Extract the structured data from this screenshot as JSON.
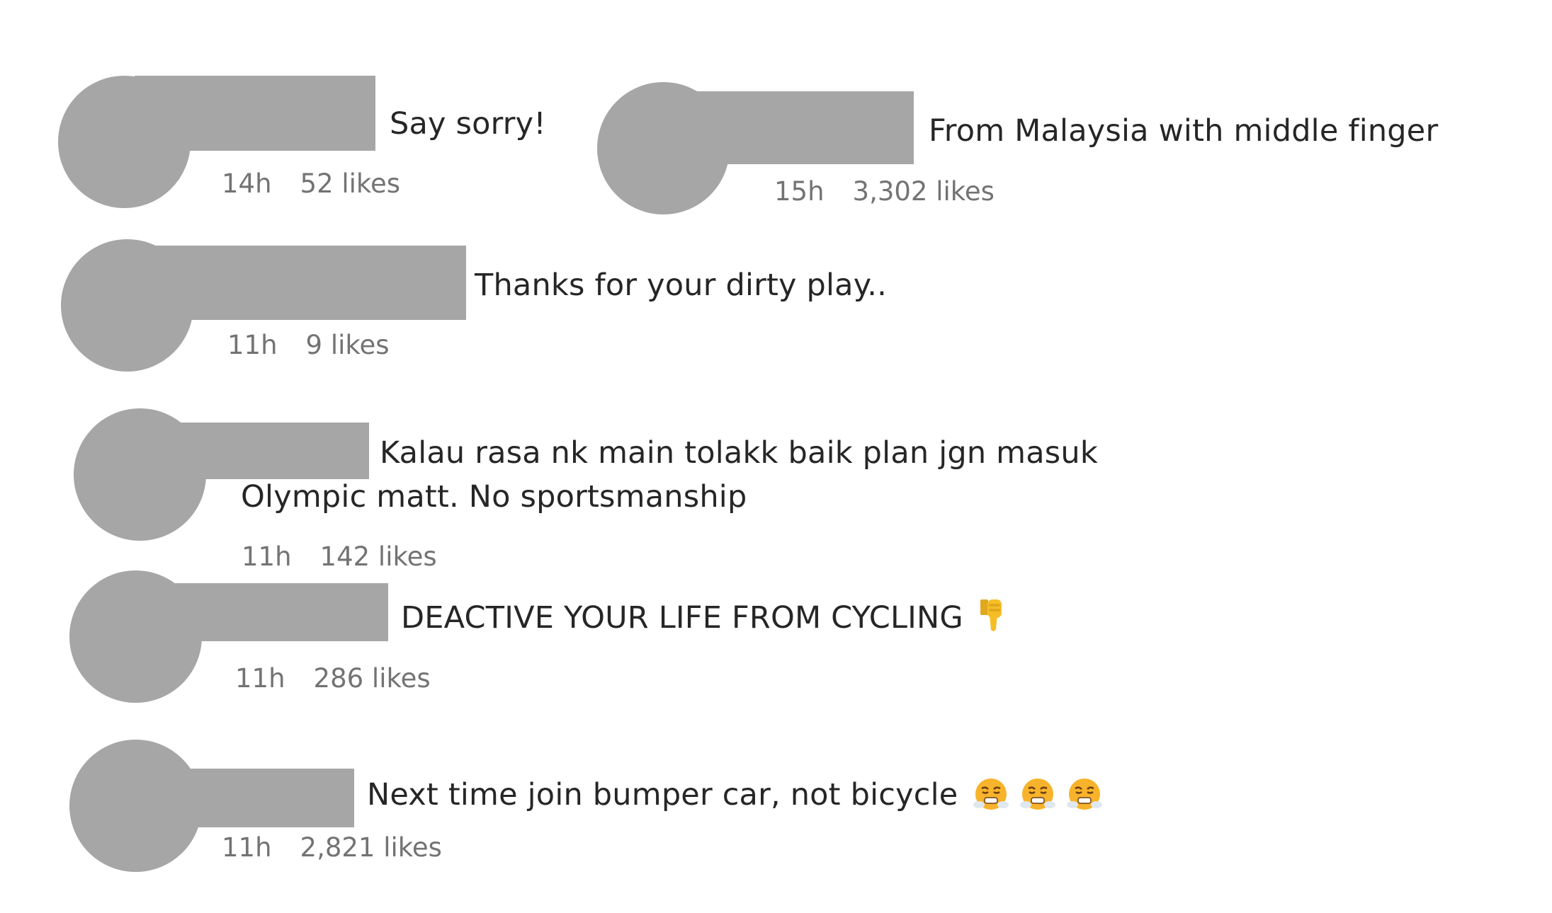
{
  "comments": [
    {
      "text": "Say sorry!",
      "time": "14h",
      "likes": "52 likes"
    },
    {
      "text": "From Malaysia with middle finger",
      "time": "15h",
      "likes": "3,302 likes"
    },
    {
      "text": "Thanks for your dirty play..",
      "time": "11h",
      "likes": "9 likes"
    },
    {
      "text_line1": "Kalau rasa nk main tolakk baik plan jgn masuk",
      "text_line2": "Olympic matt. No sportsmanship",
      "time": "11h",
      "likes": "142 likes"
    },
    {
      "text": "DEACTIVE YOUR LIFE FROM CYCLING",
      "emoji": "thumbs-down-emoji",
      "time": "11h",
      "likes": "286 likes"
    },
    {
      "text": "Next time join bumper car, not bicycle",
      "emoji": "face-with-steam-emoji",
      "emoji_count": 3,
      "time": "11h",
      "likes": "2,821 likes"
    }
  ],
  "colors": {
    "redaction": "#a6a6a6",
    "text": "#262626",
    "meta": "#737373"
  }
}
